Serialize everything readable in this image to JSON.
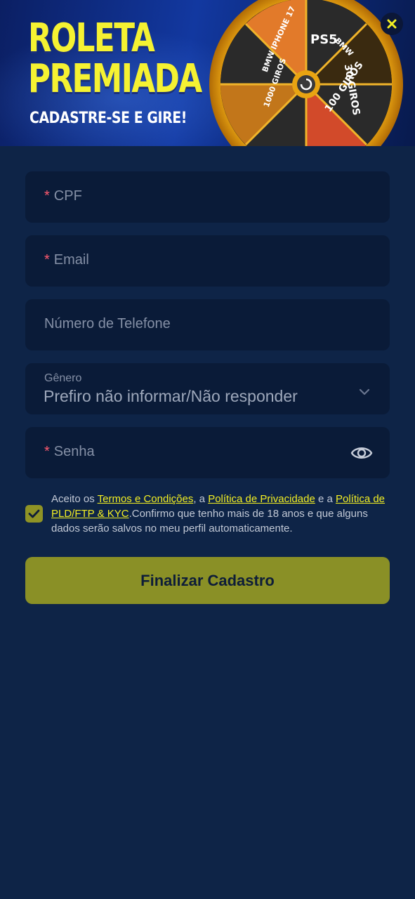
{
  "banner": {
    "title_line1": "ROLETA",
    "title_line2": "PREMIADA",
    "subtitle": "CADASTRE-SE E GIRE!",
    "wheel_prizes": [
      "PS5",
      "BMW",
      "30 GIROS",
      "100 GIROS",
      "1000 GIROS",
      "BMW",
      "IPHONE 17"
    ],
    "title_color": "#f5f232"
  },
  "close_icon": "close-icon",
  "form": {
    "cpf": {
      "required_mark": "*",
      "placeholder": "CPF"
    },
    "email": {
      "required_mark": "*",
      "placeholder": "Email"
    },
    "phone": {
      "placeholder": "Número de Telefone"
    },
    "gender": {
      "label": "Gênero",
      "value": "Prefiro não informar/Não responder"
    },
    "password": {
      "required_mark": "*",
      "placeholder": "Senha"
    }
  },
  "terms": {
    "checked": true,
    "text_1": "Aceito os ",
    "link_terms": "Termos e Condições",
    "text_2": ", a ",
    "link_privacy": "Política de Privacidade",
    "text_3": " e a ",
    "link_pld": "Política de PLD/FTP & KYC",
    "text_4": ".Confirmo que tenho mais de 18 anos e que alguns dados serão salvos no meu perfil automaticamente."
  },
  "submit_label": "Finalizar Cadastro",
  "colors": {
    "background": "#0e2447",
    "field_bg": "#0a1b38",
    "accent": "#8a9026",
    "link": "#f3ef23",
    "required": "#ff5a6f"
  }
}
